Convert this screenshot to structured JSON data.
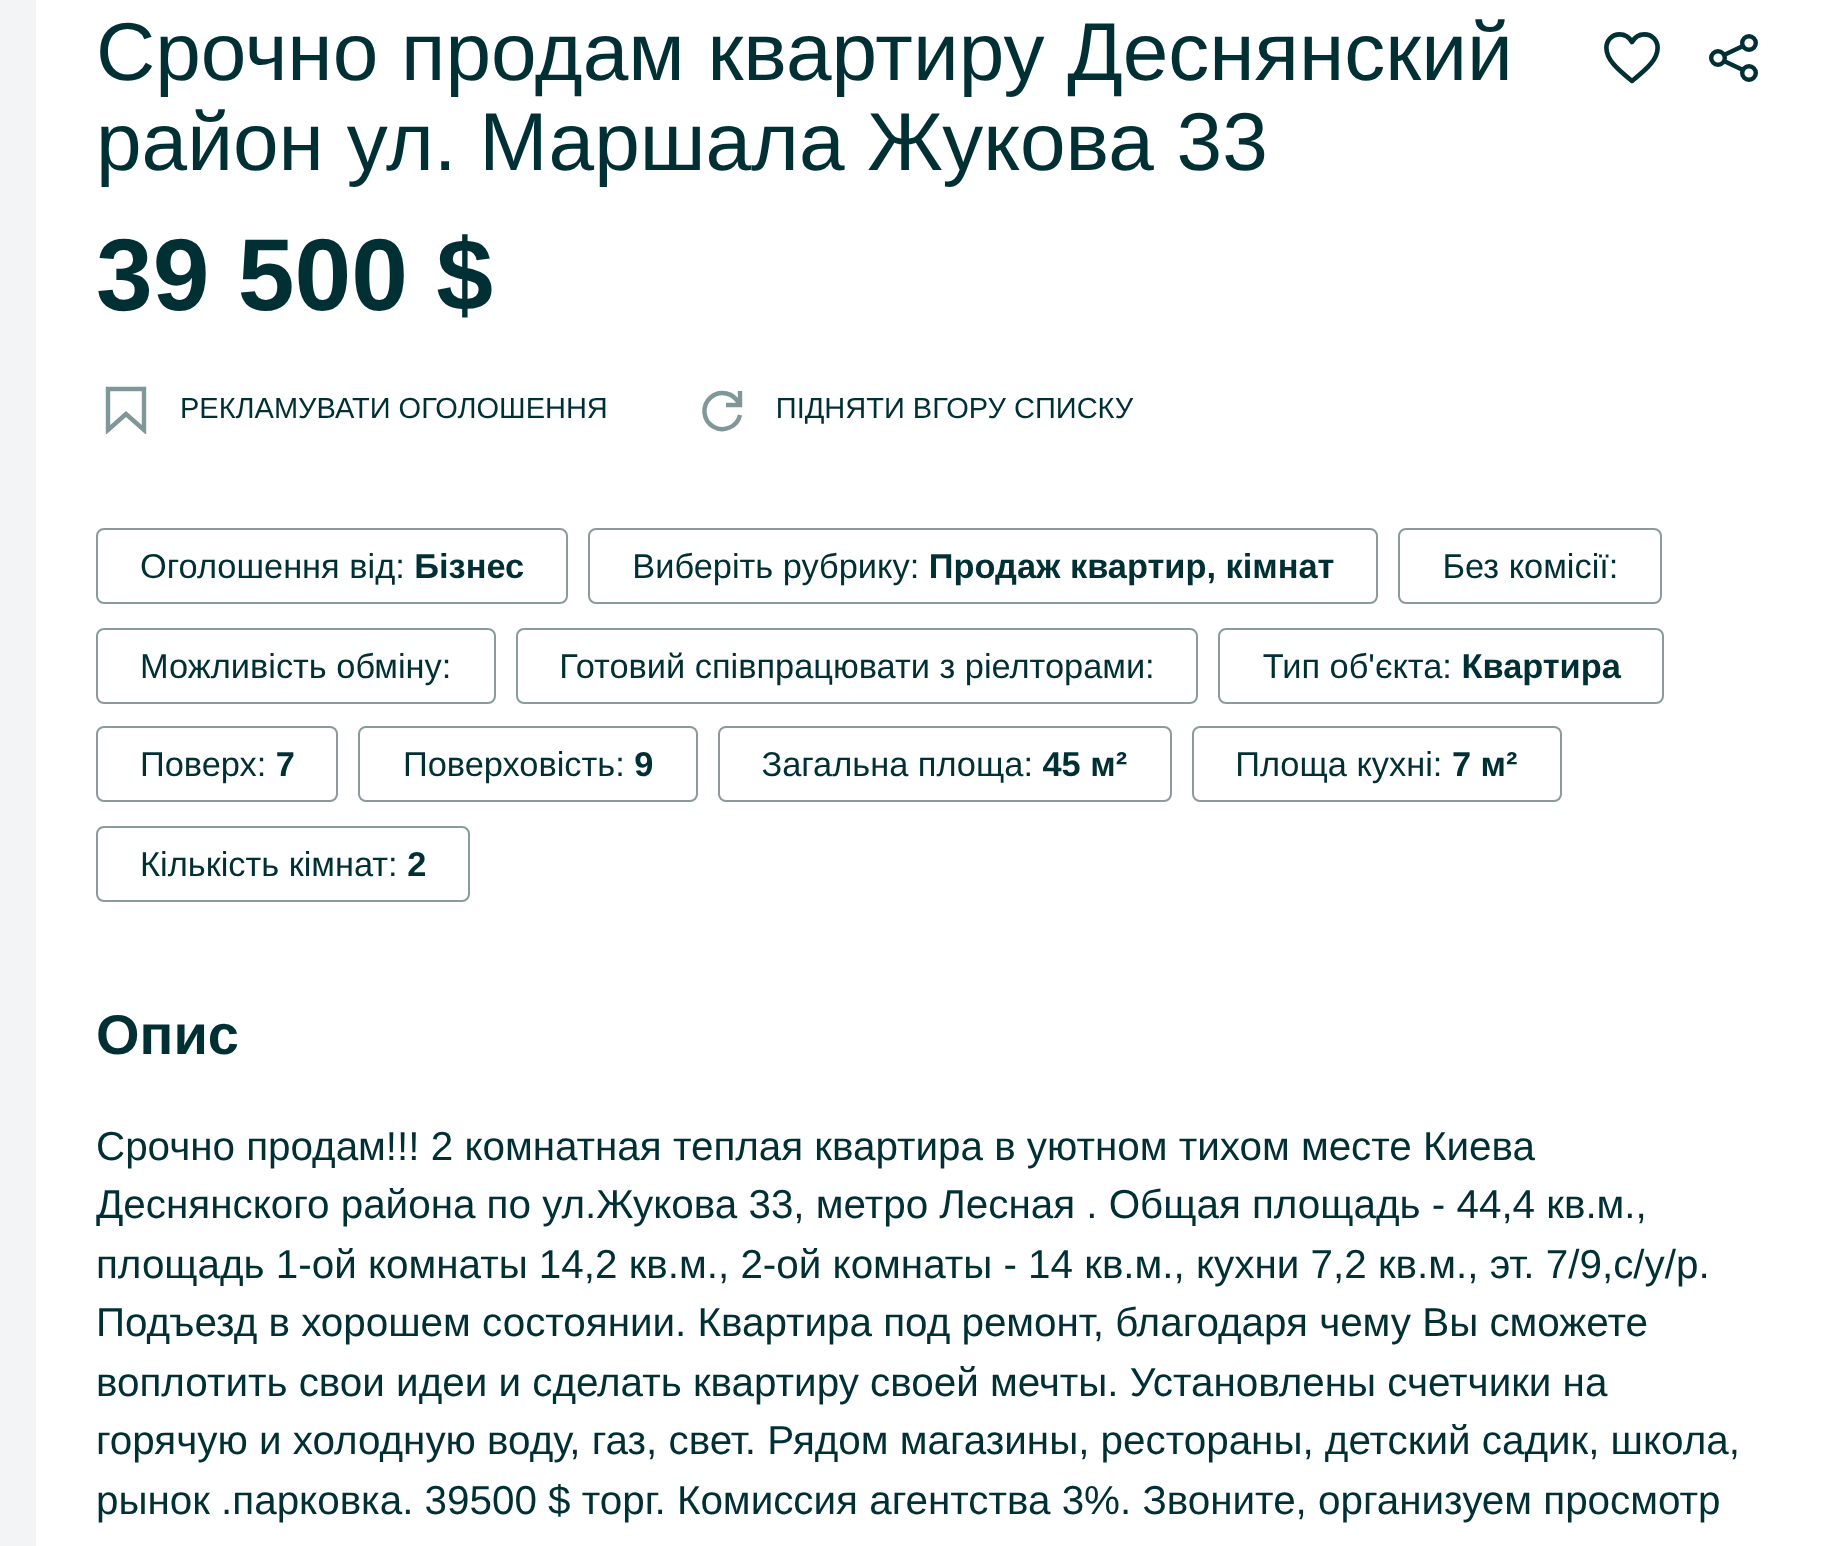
{
  "listing": {
    "title": "Срочно продам квартиру Деснянский район ул. Маршала Жукова 33",
    "price": "39 500 $"
  },
  "actions": [
    {
      "kind": "promote",
      "label": "РЕКЛАМУВАТИ ОГОЛОШЕННЯ"
    },
    {
      "kind": "bump",
      "label": "ПІДНЯТИ ВГОРУ СПИСКУ"
    }
  ],
  "parameters": [
    "Оголошення від: **Бізнес**",
    "Виберіть рубрику: **Продаж квартир, кімнат**",
    "Без комісії:",
    "Можливість обміну:",
    "Готовий співпрацювати з ріелторами:",
    "Тип об'єкта: **Квартира**",
    "Поверх: **7**",
    "Поверховість: **9**",
    "Загальна площа: **45 м²**",
    "Площа кухні: **7 м²**",
    "Кількість кімнат: **2**"
  ],
  "description": {
    "heading": "Опис",
    "text": "Срочно продам!!! 2 комнатная теплая квартира в уютном тихом месте Киева Деснянского района по ул.Жукова 33, метро Лесная . Общая площадь - 44,4 кв.м., площадь 1-ой комнаты 14,2 кв.м., 2-ой комнаты - 14 кв.м., кухни 7,2 кв.м., эт. 7/9,с/у/р. Подъезд в хорошем состоянии. Квартира под ремонт, благодаря чему Вы сможете воплотить свои идеи и сделать квартиру своей мечты. Установлены счетчики на горячую и холодную воду, газ, свет. Рядом магазины, рестораны, детский садик, школа, рынок .парковка. 39500 $ торг. Комиссия агентства 3%. Звоните, организуем просмотр"
  }
}
